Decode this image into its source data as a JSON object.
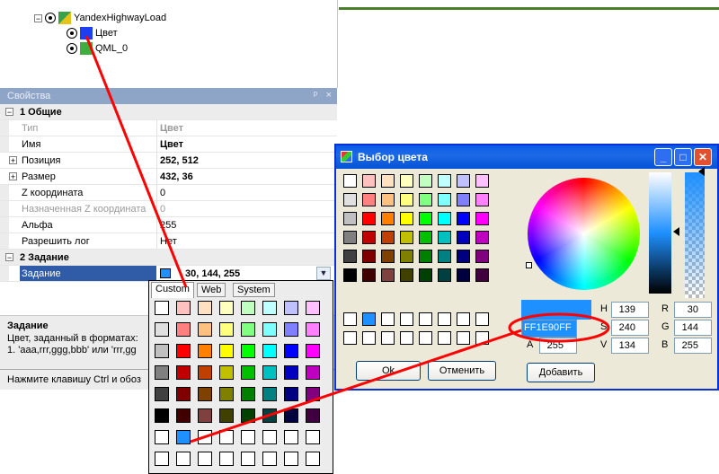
{
  "tree": {
    "items": [
      {
        "label": "YandexHighwayLoad"
      },
      {
        "label": "Цвет"
      },
      {
        "label": "QML_0"
      }
    ]
  },
  "props_panel": {
    "title": "Свойства",
    "pin": "ᵖ",
    "close": "×",
    "categories": [
      {
        "label": "1 Общие",
        "expander": "⊟"
      },
      {
        "label": "2 Задание",
        "expander": "⊟"
      }
    ],
    "rows": [
      {
        "name": "Тип",
        "value": "Цвет"
      },
      {
        "name": "Имя",
        "value": "Цвет"
      },
      {
        "name": "Позиция",
        "value": "252, 512",
        "expander": "+"
      },
      {
        "name": "Размер",
        "value": "432, 36",
        "expander": "+"
      },
      {
        "name": "Z координата",
        "value": "0"
      },
      {
        "name": "Назначенная Z координата",
        "value": "0"
      },
      {
        "name": "Альфа",
        "value": "255"
      },
      {
        "name": "Разрешить лог",
        "value": "Нет"
      },
      {
        "name": "Задание",
        "value": "30, 144, 255",
        "swatch_color": "#1e90ff"
      }
    ],
    "description": {
      "title": "Задание",
      "line1": "Цвет, заданный в форматах:",
      "line2": "1. 'aaa,rrr,ggg,bbb' или 'rrr,gg"
    },
    "status": "Нажмите клавишу Ctrl и обоз"
  },
  "dropdown": {
    "tabs": [
      "Custom",
      "Web",
      "System"
    ],
    "active_tab": "Custom",
    "rows": [
      [
        "#ffffff",
        "#ffc0c0",
        "#ffe0c0",
        "#ffffc0",
        "#c0ffc0",
        "#c0ffff",
        "#c0c0ff",
        "#ffc0ff"
      ],
      [
        "#e0e0e0",
        "#ff8080",
        "#ffc080",
        "#ffff80",
        "#80ff80",
        "#80ffff",
        "#8080ff",
        "#ff80ff"
      ],
      [
        "#c0c0c0",
        "#ff0000",
        "#ff8000",
        "#ffff00",
        "#00ff00",
        "#00ffff",
        "#0000ff",
        "#ff00ff"
      ],
      [
        "#808080",
        "#c00000",
        "#c04000",
        "#c0c000",
        "#00c000",
        "#00c0c0",
        "#0000c0",
        "#c000c0"
      ],
      [
        "#404040",
        "#800000",
        "#804000",
        "#808000",
        "#008000",
        "#008080",
        "#000080",
        "#800080"
      ],
      [
        "#000000",
        "#400000",
        "#804040",
        "#404000",
        "#004000",
        "#004040",
        "#000040",
        "#400040"
      ],
      [
        "#ffffff",
        "#1e90ff",
        "#ffffff",
        "#ffffff",
        "#ffffff",
        "#ffffff",
        "#ffffff",
        "#ffffff"
      ],
      [
        "#ffffff",
        "#ffffff",
        "#ffffff",
        "#ffffff",
        "#ffffff",
        "#ffffff",
        "#ffffff",
        "#ffffff"
      ]
    ]
  },
  "dialog": {
    "title": "Выбор цвета",
    "minimize": "_",
    "maximize": "□",
    "close": "✕",
    "basic_rows": [
      [
        "#ffffff",
        "#ffc0c0",
        "#ffe0c0",
        "#ffffc0",
        "#c0ffc0",
        "#c0ffff",
        "#c0c0ff",
        "#ffc0ff"
      ],
      [
        "#e0e0e0",
        "#ff8080",
        "#ffc080",
        "#ffff80",
        "#80ff80",
        "#80ffff",
        "#8080ff",
        "#ff80ff"
      ],
      [
        "#c0c0c0",
        "#ff0000",
        "#ff8000",
        "#ffff00",
        "#00ff00",
        "#00ffff",
        "#0000ff",
        "#ff00ff"
      ],
      [
        "#808080",
        "#c00000",
        "#c04000",
        "#c0c000",
        "#00c000",
        "#00c0c0",
        "#0000c0",
        "#c000c0"
      ],
      [
        "#404040",
        "#800000",
        "#804000",
        "#808000",
        "#008000",
        "#008080",
        "#000080",
        "#800080"
      ],
      [
        "#000000",
        "#400000",
        "#804040",
        "#404000",
        "#004000",
        "#004040",
        "#000040",
        "#400040"
      ]
    ],
    "custom_rows": [
      [
        "#ffffff",
        "#1e90ff",
        "#ffffff",
        "#ffffff",
        "#ffffff",
        "#ffffff",
        "#ffffff",
        "#ffffff"
      ],
      [
        "#ffffff",
        "#ffffff",
        "#ffffff",
        "#ffffff",
        "#ffffff",
        "#ffffff",
        "#ffffff",
        "#ffffff"
      ]
    ],
    "hex_value": "FF1E90FF",
    "selected_color": "#1e90ff",
    "fields": {
      "H": "139",
      "S": "240",
      "V": "134",
      "R": "30",
      "G": "144",
      "B": "255",
      "A": "255"
    },
    "ok_label": "Ok",
    "cancel_label": "Отменить",
    "add_label": "Добавить"
  },
  "colors": {
    "annotation_red": "#ff0000",
    "selection_blue": "#2f5ba7",
    "xp_title_blue": "#0a5be9"
  }
}
